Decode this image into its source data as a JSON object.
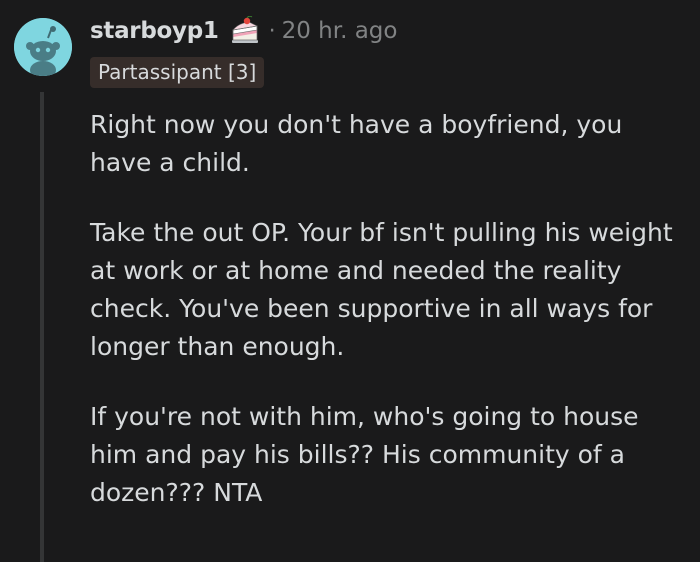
{
  "comment": {
    "author": "starboyp1",
    "award_icon": "cake-day-icon",
    "separator": "·",
    "timestamp": "20 hr. ago",
    "flair": "Partassipant [3]",
    "paragraphs": [
      "Right now you don't have a boyfriend, you have a child.",
      "Take the out OP. Your bf isn't pulling his weight at work or at home and needed the reality check. You've been supportive in all ways for longer than enough.",
      "If you're not with him, who's going to house him and pay his bills?? His community of a dozen??? NTA"
    ]
  },
  "colors": {
    "background": "#1a1a1b",
    "text": "#d7dadc",
    "muted": "#818384",
    "avatar_bg": "#7fd6e0",
    "flair_bg": "#362d2a",
    "thread_line": "#343536"
  }
}
